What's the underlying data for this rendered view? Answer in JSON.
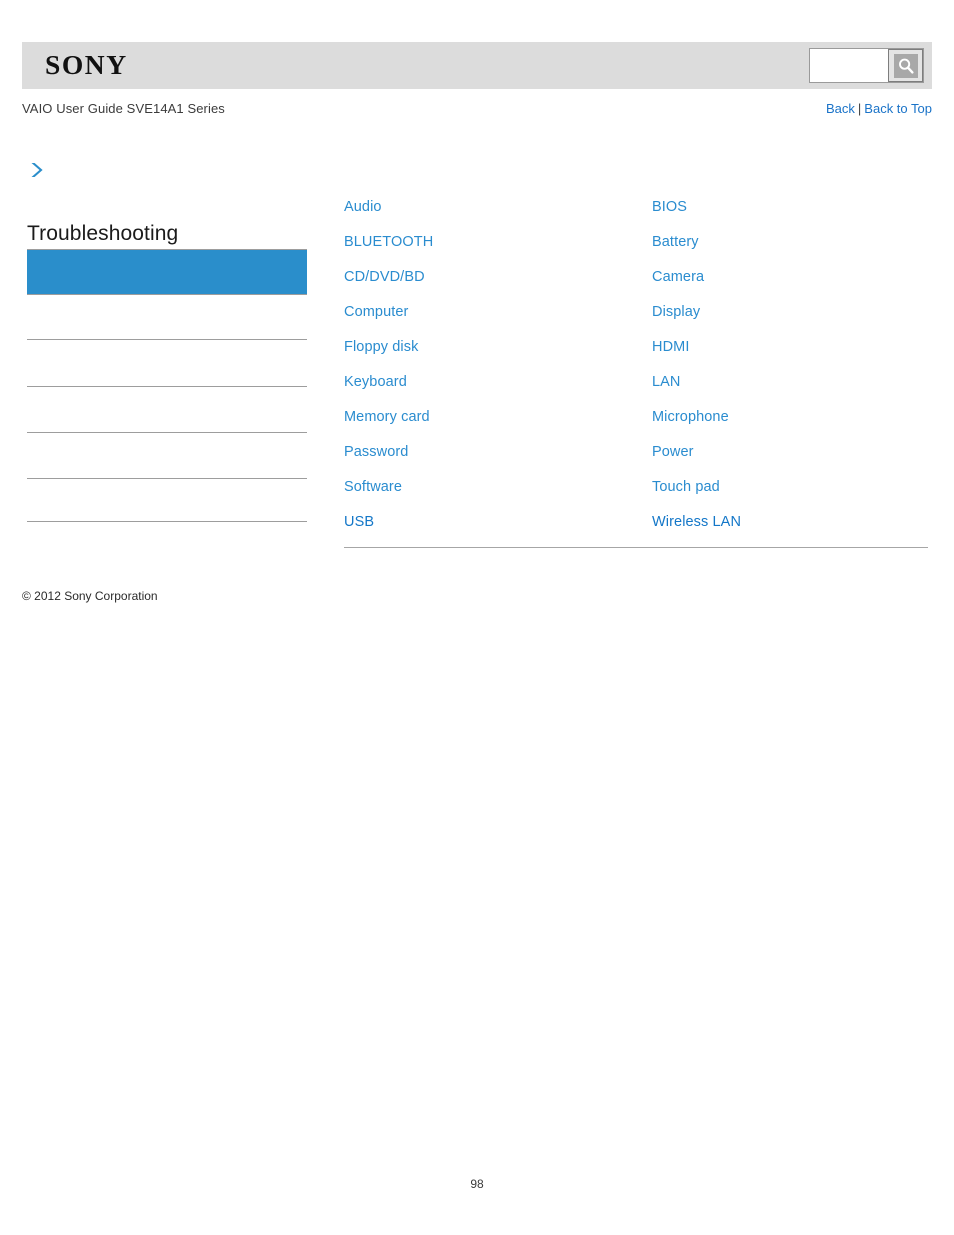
{
  "header": {
    "logo_text": "SONY",
    "search": {
      "value": "",
      "placeholder": "",
      "icon": "search-icon"
    }
  },
  "subheader": {
    "guide_title": "VAIO User Guide SVE14A1 Series",
    "back_label": "Back",
    "separator": "|",
    "back_to_top_label": "Back to Top"
  },
  "sidebar": {
    "expand_icon": "chevron-right-icon",
    "heading": "Troubleshooting",
    "selected_item_label": "",
    "items": [
      {
        "label": ""
      },
      {
        "label": ""
      },
      {
        "label": ""
      },
      {
        "label": ""
      },
      {
        "label": ""
      }
    ]
  },
  "main": {
    "columns": [
      {
        "links": [
          "Audio",
          "BLUETOOTH",
          "CD/DVD/BD",
          "Computer",
          "Floppy disk",
          "Keyboard",
          "Memory card",
          "Password",
          "Software",
          "USB"
        ]
      },
      {
        "links": [
          "BIOS",
          "Battery",
          "Camera",
          "Display",
          "HDMI",
          "LAN",
          "Microphone",
          "Power",
          "Touch pad",
          "Wireless LAN"
        ]
      }
    ]
  },
  "footer": {
    "copyright": "© 2012 Sony Corporation",
    "page_number": "98"
  },
  "colors": {
    "link_blue": "#2a8ccf",
    "accent_blue": "#1a73c8",
    "selected_fill": "#2a8ecb",
    "header_band": "#dcdcdc",
    "rule_gray": "#9d9d9d"
  }
}
